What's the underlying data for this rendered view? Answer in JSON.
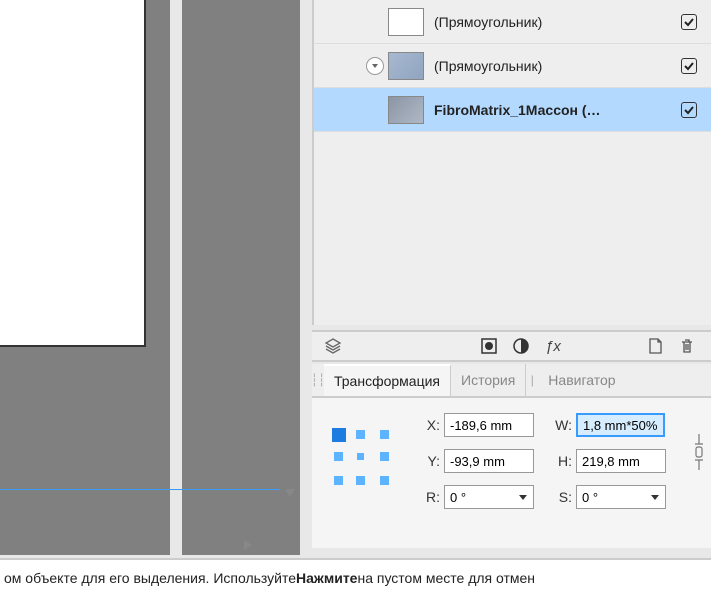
{
  "layers": {
    "items": [
      {
        "label": "(Прямоугольник)",
        "bold": false,
        "selected": false,
        "thumb": "white",
        "expand": false,
        "checked": true
      },
      {
        "label": "(Прямоугольник)",
        "bold": false,
        "selected": false,
        "thumb": "blue",
        "expand": true,
        "checked": true
      },
      {
        "label": "FibroMatrix_1Массон (…",
        "bold": true,
        "selected": true,
        "thumb": "img",
        "expand": false,
        "checked": true
      }
    ]
  },
  "iconbar": {
    "fx": "ƒx"
  },
  "tabs": {
    "active": "Трансформация",
    "items": [
      "Трансформация",
      "История",
      "Навигатор"
    ]
  },
  "transform": {
    "x_label": "X:",
    "x": "-189,6 mm",
    "y_label": "Y:",
    "y": "-93,9 mm",
    "w_label": "W:",
    "w": "1,8 mm*50%",
    "h_label": "H:",
    "h": "219,8 mm",
    "r_label": "R:",
    "r": "0 °",
    "s_label": "S:",
    "s": "0 °"
  },
  "status": {
    "pre": "ом объекте для его выделения. Используйте ",
    "bold": "Нажмите",
    "post": " на пустом месте для отмен"
  }
}
